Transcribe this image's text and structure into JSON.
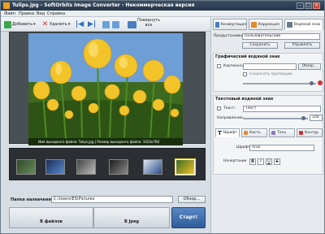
{
  "window": {
    "title": "Tulips.jpg - SoftOrbits Image Converter - Некоммерческая версия",
    "controls": {
      "minimize": "–",
      "maximize": "□",
      "close": "×"
    }
  },
  "menu": [
    "Файл",
    "Правка",
    "Вид",
    "Справка"
  ],
  "toolbar": {
    "add_label": "Добавить",
    "add_arrow": "▾",
    "delete_label": "Удалить",
    "delete_arrow": "▾",
    "rotate_label_1": "Повернуть",
    "rotate_label_2": "все"
  },
  "preview": {
    "caption": "Имя выходного файла: Tulips.jpg | Размер выходного файла: 1024x768"
  },
  "destination": {
    "label": "Папка назначения:",
    "path": "C:\\Users\\ES\\Pictures",
    "browse_label": "Обзор..."
  },
  "steps": {
    "files_label": "В файлов",
    "format_label": "В Jpeg",
    "start_label": "Старт!"
  },
  "panel": {
    "tabs": [
      {
        "label": "Конвертация",
        "icon": "convert-icon"
      },
      {
        "label": "Коррекция",
        "icon": "correction-icon"
      },
      {
        "label": "Водяной знак",
        "icon": "watermark-icon"
      }
    ],
    "preset": {
      "label": "Предустановки",
      "value": "Пользовательский",
      "save_label": "Сохранить",
      "manage_label": "Управлять"
    },
    "graphic_watermark": {
      "title": "Графический водяной знак",
      "image_label": "Картинка:",
      "browse_label": "Обзор...",
      "save_ratio_label": "Сохранять пропорции"
    },
    "text_watermark": {
      "title": "Текстовый водяной знак",
      "text_label": "Текст:",
      "text_value": "Текст",
      "direction_label": "Направление:",
      "opacity_value": "100",
      "style_tabs": [
        "Шрифт",
        "Кисть",
        "Тень",
        "Контур"
      ],
      "font_label": "Шрифт:",
      "font_value": "Arial",
      "style_label": "Начертание",
      "style_buttons": [
        "B",
        "I",
        "U",
        "S"
      ]
    }
  },
  "colors": {
    "accent": "#2e5c9a",
    "titlebar": "#25364a"
  }
}
